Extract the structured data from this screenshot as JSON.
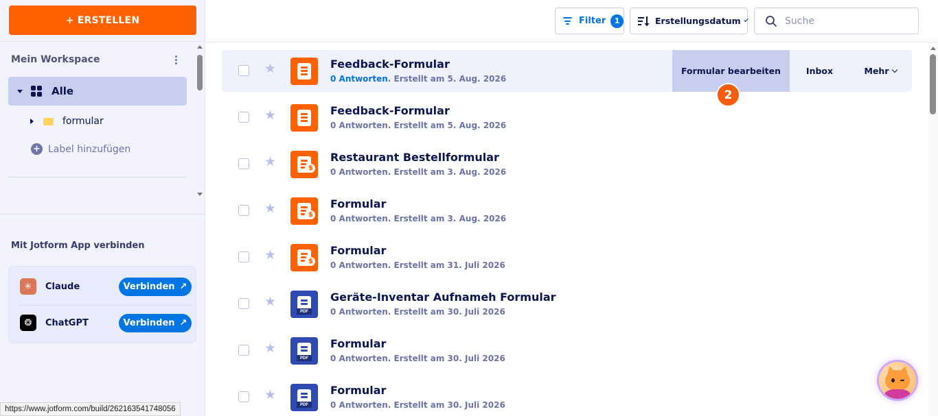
{
  "sidebar": {
    "create_label": "+ ERSTELLEN",
    "workspace_title": "Mein Workspace",
    "all_label": "Alle",
    "folder_label": "formular",
    "add_label": "Label hinzufügen",
    "connect_title": "Mit Jotform App verbinden",
    "apps": [
      {
        "name": "Claude",
        "button": "Verbinden",
        "icon": "claude-logo",
        "color": "#d97757"
      },
      {
        "name": "ChatGPT",
        "button": "Verbinden",
        "icon": "openai-logo",
        "color": "#000000"
      }
    ]
  },
  "header": {
    "filter_label": "Filter",
    "filter_count": "1",
    "sort_label": "Erstellungsdatum",
    "search_placeholder": "Suche"
  },
  "forms": [
    {
      "title": "Feedback-Formular",
      "responses": "0 Antworten",
      "created": ". Erstellt am 5. Aug. 2026",
      "icon": "form-icon",
      "highlighted": true
    },
    {
      "title": "Feedback-Formular",
      "responses": "0 Antworten",
      "created": ". Erstellt am 5. Aug. 2026",
      "icon": "form-icon"
    },
    {
      "title": "Restaurant Bestellformular",
      "responses": "0 Antworten",
      "created": ". Erstellt am 3. Aug. 2026",
      "icon": "payment-form-icon"
    },
    {
      "title": "Formular",
      "responses": "0 Antworten",
      "created": ". Erstellt am 3. Aug. 2026",
      "icon": "payment-form-icon"
    },
    {
      "title": "Formular",
      "responses": "0 Antworten",
      "created": ". Erstellt am 31. Juli 2026",
      "icon": "payment-form-icon"
    },
    {
      "title": "Geräte-Inventar Aufnameh Formular",
      "responses": "0 Antworten",
      "created": ". Erstellt am 30. Juli 2026",
      "icon": "pdf-form-icon"
    },
    {
      "title": "Formular",
      "responses": "0 Antworten",
      "created": ". Erstellt am 30. Juli 2026",
      "icon": "pdf-form-icon"
    },
    {
      "title": "Formular",
      "responses": "0 Antworten",
      "created": ". Erstellt am 30. Juli 2026",
      "icon": "pdf-form-icon"
    }
  ],
  "row_actions": {
    "edit": "Formular bearbeiten",
    "inbox": "Inbox",
    "more": "Mehr"
  },
  "step_badge": "2",
  "status_url": "https://www.jotform.com/build/262163541748056",
  "colors": {
    "accent": "#0075e3",
    "create": "#ff6100",
    "form_orange": "#ff6100",
    "form_blue": "#2f4bb1",
    "highlight": "#c8ceed"
  }
}
